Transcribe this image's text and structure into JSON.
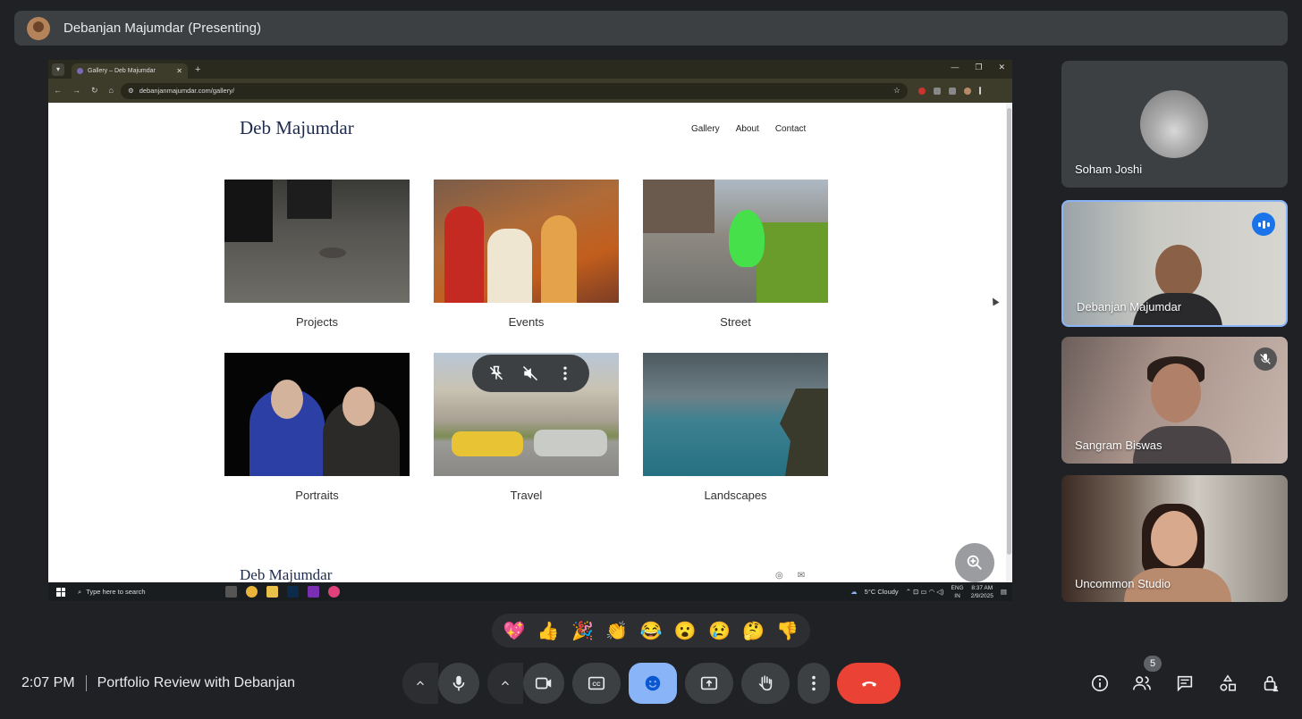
{
  "meeting": {
    "presenter_banner": "Debanjan Majumdar (Presenting)",
    "time": "2:07 PM",
    "title": "Portfolio Review with Debanjan",
    "participant_count": "5"
  },
  "browser": {
    "tab_title": "Gallery – Deb Majumdar",
    "url": "debanjanmajumdar.com/gallery/"
  },
  "site": {
    "brand": "Deb Majumdar",
    "nav": [
      "Gallery",
      "About",
      "Contact"
    ],
    "gallery": [
      "Projects",
      "Events",
      "Street",
      "Portraits",
      "Travel",
      "Landscapes"
    ],
    "footer_brand": "Deb Majumdar"
  },
  "taskbar": {
    "search_placeholder": "Type here to search",
    "weather": "5°C  Cloudy",
    "lang": "ENG",
    "region": "IN",
    "time": "8:37 AM",
    "date": "2/9/2025"
  },
  "participants": [
    {
      "name": "Soham Joshi"
    },
    {
      "name": "Debanjan Majumdar"
    },
    {
      "name": "Sangram Biswas"
    },
    {
      "name": "Uncommon Studio"
    }
  ],
  "reactions": [
    "💖",
    "👍",
    "🎉",
    "👏",
    "😂",
    "😮",
    "😢",
    "🤔",
    "👎"
  ],
  "colors": {
    "background": "#202124",
    "control": "#3c4043",
    "reaction_active": "#8ab4f8",
    "end_call": "#ea4335",
    "speaking": "#1a73e8"
  }
}
